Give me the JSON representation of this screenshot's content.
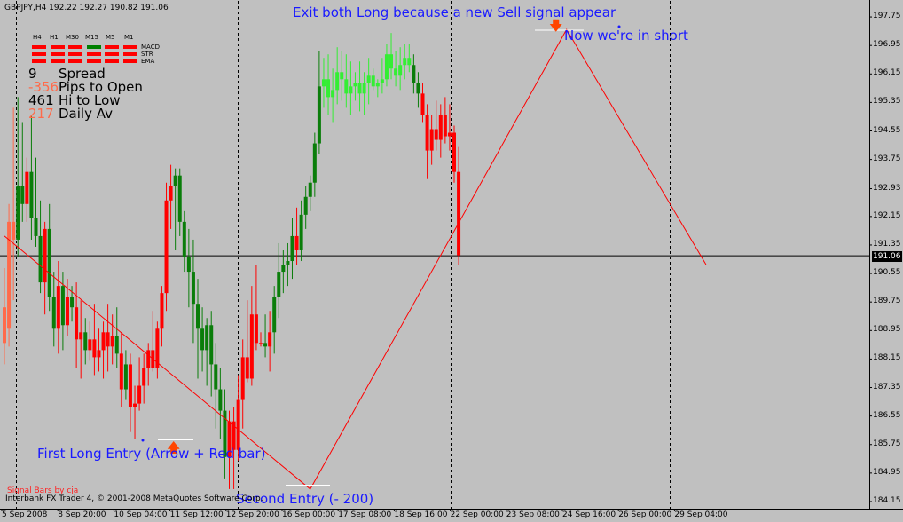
{
  "info_line": "GBPJPY,H4  192.22 192.27 190.82 191.06",
  "panel": {
    "timeframes": [
      "H4",
      "H1",
      "M30",
      "M15",
      "M5",
      "M1"
    ],
    "rows": [
      {
        "label": "MACD",
        "colors": [
          "#ff0000",
          "#ff0000",
          "#ff0000",
          "#008000",
          "#ff0000",
          "#ff0000"
        ]
      },
      {
        "label": "STR",
        "colors": [
          "#ff0000",
          "#ff0000",
          "#ff0000",
          "#ff0000",
          "#ff0000",
          "#ff0000"
        ]
      },
      {
        "label": "EMA",
        "colors": [
          "#ff0000",
          "#ff0000",
          "#ff0000",
          "#ff0000",
          "#ff0000",
          "#ff0000"
        ]
      }
    ]
  },
  "stats": [
    {
      "value": "9",
      "label": "Spread",
      "value_color": "#000000"
    },
    {
      "value": "-356",
      "label": "Pips to Open",
      "value_color": "#ff6a4a"
    },
    {
      "value": "461",
      "label": "Hi to Low",
      "value_color": "#000000"
    },
    {
      "value": "217",
      "label": "Daily Av",
      "value_color": "#ff6a4a"
    }
  ],
  "annotations": {
    "exit": "Exit both Long because a new Sell signal appear",
    "short": "Now we're in short",
    "first_long": "First Long Entry (Arrow + Red bar)",
    "second_entry": "Second Entry (- 200)"
  },
  "signal_label": "Signal Bars by cja",
  "footer": "Interbank FX Trader 4, © 2001-2008 MetaQuotes Software Corp.",
  "current_price": "191.06",
  "chart_data": {
    "type": "candlestick",
    "symbol": "GBPJPY",
    "timeframe": "H4",
    "y_ticks": [
      "197.75",
      "196.95",
      "196.15",
      "195.35",
      "194.55",
      "193.75",
      "192.93",
      "192.15",
      "191.35",
      "190.55",
      "189.75",
      "188.95",
      "188.15",
      "187.35",
      "186.55",
      "185.75",
      "184.95",
      "184.15"
    ],
    "ylim": [
      183.95,
      198.2
    ],
    "x_ticks": [
      "5 Sep 2008",
      "8 Sep 20:00",
      "10 Sep 04:00",
      "11 Sep 12:00",
      "12 Sep 20:00",
      "16 Sep 00:00",
      "17 Sep 08:00",
      "18 Sep 16:00",
      "22 Sep 00:00",
      "23 Sep 08:00",
      "24 Sep 16:00",
      "26 Sep 00:00",
      "29 Sep 04:00"
    ],
    "zigzag": [
      {
        "bar": 0,
        "price": 191.6
      },
      {
        "bar": 68,
        "price": 184.5
      },
      {
        "bar": 125,
        "price": 197.4
      },
      {
        "bar": 156,
        "price": 190.8
      }
    ],
    "bars": [
      {
        "o": 189.6,
        "h": 190.7,
        "l": 188.0,
        "c": 188.6,
        "color": "tomato"
      },
      {
        "o": 189.0,
        "h": 192.5,
        "l": 188.5,
        "c": 192.0,
        "color": "tomato"
      },
      {
        "o": 192.0,
        "h": 195.2,
        "l": 189.8,
        "c": 191.5,
        "color": "tomato"
      },
      {
        "o": 191.5,
        "h": 195.5,
        "l": 191.0,
        "c": 193.0,
        "color": "green"
      },
      {
        "o": 193.0,
        "h": 194.8,
        "l": 192.0,
        "c": 192.5,
        "color": "green"
      },
      {
        "o": 192.5,
        "h": 193.8,
        "l": 192.0,
        "c": 193.4,
        "color": "red"
      },
      {
        "o": 193.4,
        "h": 195.0,
        "l": 191.5,
        "c": 192.1,
        "color": "green"
      },
      {
        "o": 192.1,
        "h": 193.8,
        "l": 191.3,
        "c": 191.6,
        "color": "green"
      },
      {
        "o": 191.6,
        "h": 192.6,
        "l": 190.0,
        "c": 190.3,
        "color": "green"
      },
      {
        "o": 190.3,
        "h": 192.0,
        "l": 189.4,
        "c": 191.8,
        "color": "red"
      },
      {
        "o": 191.8,
        "h": 192.5,
        "l": 189.5,
        "c": 189.9,
        "color": "green"
      },
      {
        "o": 189.9,
        "h": 190.6,
        "l": 188.5,
        "c": 189.0,
        "color": "green"
      },
      {
        "o": 189.0,
        "h": 190.9,
        "l": 188.3,
        "c": 190.2,
        "color": "red"
      },
      {
        "o": 190.2,
        "h": 190.6,
        "l": 188.4,
        "c": 189.1,
        "color": "green"
      },
      {
        "o": 189.1,
        "h": 190.4,
        "l": 188.8,
        "c": 189.9,
        "color": "red"
      },
      {
        "o": 189.9,
        "h": 190.2,
        "l": 189.2,
        "c": 189.6,
        "color": "green"
      },
      {
        "o": 189.6,
        "h": 190.3,
        "l": 187.9,
        "c": 188.7,
        "color": "red"
      },
      {
        "o": 188.7,
        "h": 189.8,
        "l": 187.6,
        "c": 188.9,
        "color": "red"
      },
      {
        "o": 188.9,
        "h": 189.3,
        "l": 188.0,
        "c": 188.4,
        "color": "green"
      },
      {
        "o": 188.4,
        "h": 189.2,
        "l": 188.1,
        "c": 188.7,
        "color": "red"
      },
      {
        "o": 188.7,
        "h": 189.7,
        "l": 187.7,
        "c": 188.2,
        "color": "red"
      },
      {
        "o": 188.2,
        "h": 189.0,
        "l": 187.8,
        "c": 188.4,
        "color": "red"
      },
      {
        "o": 188.4,
        "h": 189.2,
        "l": 187.6,
        "c": 188.9,
        "color": "red"
      },
      {
        "o": 188.9,
        "h": 189.7,
        "l": 187.8,
        "c": 188.5,
        "color": "red"
      },
      {
        "o": 188.5,
        "h": 189.4,
        "l": 188.0,
        "c": 188.8,
        "color": "red"
      },
      {
        "o": 188.8,
        "h": 189.6,
        "l": 187.9,
        "c": 188.3,
        "color": "green"
      },
      {
        "o": 188.3,
        "h": 188.9,
        "l": 186.8,
        "c": 187.3,
        "color": "red"
      },
      {
        "o": 187.3,
        "h": 188.4,
        "l": 187.0,
        "c": 188.0,
        "color": "green"
      },
      {
        "o": 188.0,
        "h": 188.3,
        "l": 186.1,
        "c": 186.8,
        "color": "red"
      },
      {
        "o": 186.8,
        "h": 187.4,
        "l": 185.9,
        "c": 186.9,
        "color": "red"
      },
      {
        "o": 186.9,
        "h": 188.2,
        "l": 186.7,
        "c": 187.4,
        "color": "red"
      },
      {
        "o": 187.4,
        "h": 188.3,
        "l": 186.9,
        "c": 187.9,
        "color": "red"
      },
      {
        "o": 187.9,
        "h": 188.6,
        "l": 187.4,
        "c": 188.4,
        "color": "red"
      },
      {
        "o": 188.4,
        "h": 189.5,
        "l": 187.8,
        "c": 187.9,
        "color": "red"
      },
      {
        "o": 187.9,
        "h": 189.2,
        "l": 187.6,
        "c": 189.0,
        "color": "red"
      },
      {
        "o": 189.0,
        "h": 190.2,
        "l": 188.5,
        "c": 190.0,
        "color": "red"
      },
      {
        "o": 190.0,
        "h": 193.1,
        "l": 189.5,
        "c": 192.6,
        "color": "red"
      },
      {
        "o": 192.6,
        "h": 193.6,
        "l": 191.8,
        "c": 193.0,
        "color": "red"
      },
      {
        "o": 193.0,
        "h": 193.5,
        "l": 191.2,
        "c": 193.3,
        "color": "green"
      },
      {
        "o": 193.3,
        "h": 193.5,
        "l": 191.6,
        "c": 192.0,
        "color": "green"
      },
      {
        "o": 192.0,
        "h": 192.3,
        "l": 190.6,
        "c": 191.0,
        "color": "green"
      },
      {
        "o": 191.0,
        "h": 191.8,
        "l": 189.6,
        "c": 190.6,
        "color": "green"
      },
      {
        "o": 190.6,
        "h": 191.5,
        "l": 188.6,
        "c": 189.7,
        "color": "green"
      },
      {
        "o": 189.7,
        "h": 190.4,
        "l": 187.6,
        "c": 189.0,
        "color": "green"
      },
      {
        "o": 189.0,
        "h": 189.6,
        "l": 187.8,
        "c": 188.4,
        "color": "green"
      },
      {
        "o": 188.4,
        "h": 189.3,
        "l": 187.4,
        "c": 189.1,
        "color": "green"
      },
      {
        "o": 189.1,
        "h": 189.5,
        "l": 187.1,
        "c": 188.0,
        "color": "green"
      },
      {
        "o": 188.0,
        "h": 188.6,
        "l": 186.2,
        "c": 187.3,
        "color": "green"
      },
      {
        "o": 187.3,
        "h": 187.9,
        "l": 185.9,
        "c": 186.7,
        "color": "green"
      },
      {
        "o": 186.7,
        "h": 187.3,
        "l": 184.8,
        "c": 185.4,
        "color": "green"
      },
      {
        "o": 185.4,
        "h": 186.7,
        "l": 184.5,
        "c": 186.4,
        "color": "red"
      },
      {
        "o": 186.4,
        "h": 186.8,
        "l": 184.5,
        "c": 185.6,
        "color": "red"
      },
      {
        "o": 185.6,
        "h": 187.7,
        "l": 185.3,
        "c": 187.0,
        "color": "red"
      },
      {
        "o": 187.0,
        "h": 188.7,
        "l": 186.2,
        "c": 188.2,
        "color": "red"
      },
      {
        "o": 188.2,
        "h": 189.8,
        "l": 187.5,
        "c": 187.6,
        "color": "red"
      },
      {
        "o": 187.6,
        "h": 190.2,
        "l": 187.4,
        "c": 189.4,
        "color": "red"
      },
      {
        "o": 189.4,
        "h": 190.8,
        "l": 188.4,
        "c": 188.6,
        "color": "red"
      },
      {
        "o": 188.6,
        "h": 188.9,
        "l": 188.5,
        "c": 188.6,
        "color": "red"
      },
      {
        "o": 188.6,
        "h": 189.4,
        "l": 188.2,
        "c": 188.5,
        "color": "green"
      },
      {
        "o": 188.5,
        "h": 189.5,
        "l": 187.8,
        "c": 188.9,
        "color": "red"
      },
      {
        "o": 188.9,
        "h": 190.2,
        "l": 188.3,
        "c": 189.9,
        "color": "green"
      },
      {
        "o": 189.9,
        "h": 191.4,
        "l": 189.3,
        "c": 190.6,
        "color": "green"
      },
      {
        "o": 190.6,
        "h": 191.2,
        "l": 190.0,
        "c": 190.8,
        "color": "green"
      },
      {
        "o": 190.8,
        "h": 191.4,
        "l": 190.2,
        "c": 190.9,
        "color": "green"
      },
      {
        "o": 190.9,
        "h": 192.1,
        "l": 190.4,
        "c": 191.6,
        "color": "green"
      },
      {
        "o": 191.6,
        "h": 192.4,
        "l": 190.8,
        "c": 191.2,
        "color": "red"
      },
      {
        "o": 191.2,
        "h": 192.6,
        "l": 190.9,
        "c": 192.2,
        "color": "green"
      },
      {
        "o": 192.2,
        "h": 193.0,
        "l": 191.8,
        "c": 192.7,
        "color": "green"
      },
      {
        "o": 192.7,
        "h": 193.3,
        "l": 192.3,
        "c": 193.1,
        "color": "green"
      },
      {
        "o": 193.1,
        "h": 194.5,
        "l": 192.7,
        "c": 194.2,
        "color": "green"
      },
      {
        "o": 194.2,
        "h": 196.8,
        "l": 193.9,
        "c": 195.8,
        "color": "green"
      },
      {
        "o": 195.8,
        "h": 196.6,
        "l": 195.2,
        "c": 196.0,
        "color": "lime"
      },
      {
        "o": 196.0,
        "h": 196.7,
        "l": 195.0,
        "c": 195.5,
        "color": "lime"
      },
      {
        "o": 195.5,
        "h": 196.3,
        "l": 194.8,
        "c": 195.7,
        "color": "lime"
      },
      {
        "o": 195.7,
        "h": 196.9,
        "l": 195.3,
        "c": 196.2,
        "color": "lime"
      },
      {
        "o": 196.2,
        "h": 196.8,
        "l": 195.4,
        "c": 196.0,
        "color": "lime"
      },
      {
        "o": 196.0,
        "h": 196.7,
        "l": 195.2,
        "c": 195.6,
        "color": "lime"
      },
      {
        "o": 195.6,
        "h": 196.5,
        "l": 195.0,
        "c": 195.8,
        "color": "lime"
      },
      {
        "o": 195.8,
        "h": 196.2,
        "l": 195.4,
        "c": 195.9,
        "color": "lime"
      },
      {
        "o": 195.9,
        "h": 196.5,
        "l": 195.1,
        "c": 195.6,
        "color": "lime"
      },
      {
        "o": 195.6,
        "h": 196.2,
        "l": 195.0,
        "c": 195.9,
        "color": "lime"
      },
      {
        "o": 195.9,
        "h": 196.6,
        "l": 195.3,
        "c": 196.1,
        "color": "lime"
      },
      {
        "o": 196.1,
        "h": 196.3,
        "l": 195.7,
        "c": 195.8,
        "color": "lime"
      },
      {
        "o": 195.8,
        "h": 196.0,
        "l": 195.5,
        "c": 195.9,
        "color": "lime"
      },
      {
        "o": 195.9,
        "h": 196.6,
        "l": 195.6,
        "c": 196.0,
        "color": "lime"
      },
      {
        "o": 196.0,
        "h": 197.0,
        "l": 195.8,
        "c": 196.7,
        "color": "lime"
      },
      {
        "o": 196.7,
        "h": 197.3,
        "l": 196.0,
        "c": 196.3,
        "color": "lime"
      },
      {
        "o": 196.3,
        "h": 196.8,
        "l": 195.8,
        "c": 196.1,
        "color": "lime"
      },
      {
        "o": 196.1,
        "h": 196.9,
        "l": 195.7,
        "c": 196.4,
        "color": "lime"
      },
      {
        "o": 196.4,
        "h": 197.0,
        "l": 196.0,
        "c": 196.6,
        "color": "lime"
      },
      {
        "o": 196.6,
        "h": 197.0,
        "l": 196.2,
        "c": 196.4,
        "color": "lime"
      },
      {
        "o": 196.4,
        "h": 196.7,
        "l": 195.6,
        "c": 195.9,
        "color": "green"
      },
      {
        "o": 195.9,
        "h": 196.2,
        "l": 195.2,
        "c": 195.6,
        "color": "green"
      },
      {
        "o": 195.6,
        "h": 195.9,
        "l": 194.8,
        "c": 195.0,
        "color": "red"
      },
      {
        "o": 195.0,
        "h": 195.3,
        "l": 193.2,
        "c": 194.0,
        "color": "red"
      },
      {
        "o": 194.0,
        "h": 195.0,
        "l": 193.6,
        "c": 194.6,
        "color": "red"
      },
      {
        "o": 194.6,
        "h": 195.4,
        "l": 194.0,
        "c": 194.3,
        "color": "red"
      },
      {
        "o": 194.3,
        "h": 195.3,
        "l": 193.8,
        "c": 195.0,
        "color": "red"
      },
      {
        "o": 195.0,
        "h": 195.5,
        "l": 194.2,
        "c": 194.4,
        "color": "red"
      },
      {
        "o": 194.4,
        "h": 195.3,
        "l": 194.0,
        "c": 194.5,
        "color": "red"
      },
      {
        "o": 194.5,
        "h": 194.7,
        "l": 193.1,
        "c": 193.4,
        "color": "red"
      },
      {
        "o": 193.4,
        "h": 194.1,
        "l": 190.8,
        "c": 191.06,
        "color": "red"
      }
    ]
  }
}
